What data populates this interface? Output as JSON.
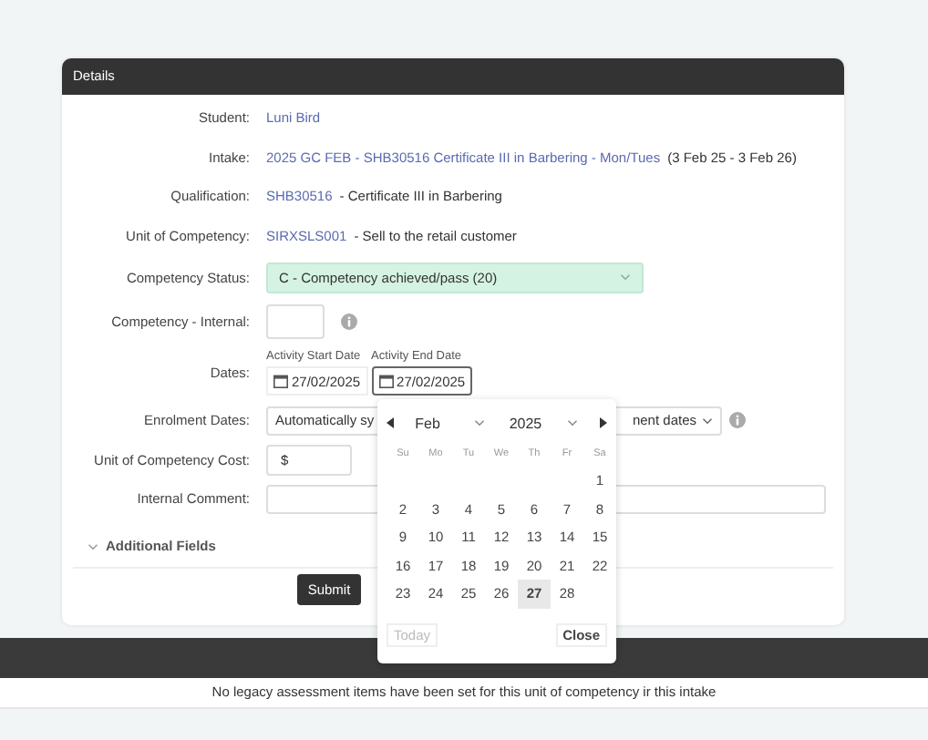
{
  "panel": {
    "title": "Details"
  },
  "fields": [
    {
      "kind": "link",
      "label": "Student:",
      "link": "Luni Bird"
    },
    {
      "kind": "link",
      "label": "Intake:",
      "link": "2025 GC FEB - SHB30516 Certificate III in Barbering - Mon/Tues",
      "suffix": "(3 Feb 25 - 3 Feb 26)"
    },
    {
      "kind": "link",
      "label": "Qualification:",
      "link": "SHB30516",
      "suffix": "- Certificate III in Barbering"
    },
    {
      "kind": "link",
      "label": "Unit of Competency:",
      "link": "SIRXSLS001",
      "suffix": "- Sell to the retail customer"
    },
    {
      "kind": "status",
      "label": "Competency Status:",
      "value": "C - Competency achieved/pass (20)"
    },
    {
      "kind": "box",
      "label": "Competency - Internal:"
    },
    {
      "kind": "dates",
      "label": "Dates:",
      "start_label": "Activity Start Date",
      "start": "27/02/2025",
      "end_label": "Activity End Date",
      "end": "27/02/2025"
    },
    {
      "kind": "split-select",
      "label": "Enrolment Dates:",
      "left": "Automatically sy",
      "right": "nent dates"
    },
    {
      "kind": "money",
      "label": "Unit of Competency Cost:",
      "prefix": "$"
    },
    {
      "kind": "comment",
      "label": "Internal Comment:"
    }
  ],
  "additional": {
    "label": "Additional Fields",
    "expanded": false
  },
  "submit": "Submit",
  "datepicker": {
    "month": "Feb",
    "year": "2025",
    "weekdays": [
      "Su",
      "Mo",
      "Tu",
      "We",
      "Th",
      "Fr",
      "Sa"
    ],
    "weeks": [
      [
        {
          "day": "1",
          "selected": false
        }
      ],
      [
        {
          "day": "2",
          "selected": false
        },
        {
          "day": "3",
          "selected": false
        },
        {
          "day": "4",
          "selected": false
        },
        {
          "day": "5",
          "selected": false
        },
        {
          "day": "6",
          "selected": false
        },
        {
          "day": "7",
          "selected": false
        },
        {
          "day": "8",
          "selected": false
        }
      ],
      [
        {
          "day": "9",
          "selected": false
        },
        {
          "day": "10",
          "selected": false
        },
        {
          "day": "11",
          "selected": false
        },
        {
          "day": "12",
          "selected": false
        },
        {
          "day": "13",
          "selected": false
        },
        {
          "day": "14",
          "selected": false
        },
        {
          "day": "15",
          "selected": false
        }
      ],
      [
        {
          "day": "16",
          "selected": false
        },
        {
          "day": "17",
          "selected": false
        },
        {
          "day": "18",
          "selected": false
        },
        {
          "day": "19",
          "selected": false
        },
        {
          "day": "20",
          "selected": false
        },
        {
          "day": "21",
          "selected": false
        },
        {
          "day": "22",
          "selected": false
        }
      ],
      [
        {
          "day": "23",
          "selected": false
        },
        {
          "day": "24",
          "selected": false
        },
        {
          "day": "25",
          "selected": false
        },
        {
          "day": "26",
          "selected": false
        },
        {
          "day": "27",
          "selected": true
        },
        {
          "day": "28",
          "selected": false
        }
      ]
    ],
    "today": {
      "label": "Today",
      "disabled": true
    },
    "close": "Close"
  },
  "notice": "No legacy assessment items have been set for this unit of competency ir this intake"
}
